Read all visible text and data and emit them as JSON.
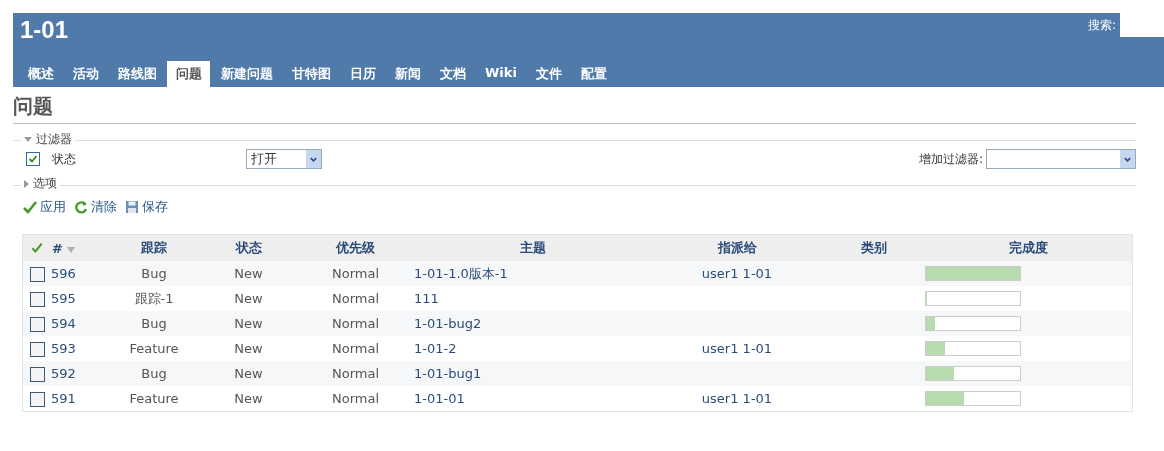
{
  "header": {
    "project_title": "1-01",
    "search_label": "搜索:"
  },
  "tabs": [
    {
      "label": "概述",
      "selected": false
    },
    {
      "label": "活动",
      "selected": false
    },
    {
      "label": "路线图",
      "selected": false
    },
    {
      "label": "问题",
      "selected": true
    },
    {
      "label": "新建问题",
      "selected": false
    },
    {
      "label": "甘特图",
      "selected": false
    },
    {
      "label": "日历",
      "selected": false
    },
    {
      "label": "新闻",
      "selected": false
    },
    {
      "label": "文档",
      "selected": false
    },
    {
      "label": "Wiki",
      "selected": false
    },
    {
      "label": "文件",
      "selected": false
    },
    {
      "label": "配置",
      "selected": false
    }
  ],
  "page_title": "问题",
  "filters": {
    "legend": "过滤器",
    "expanded": true,
    "status_label": "状态",
    "status_checked": true,
    "status_value": "打开",
    "add_filter_label": "增加过滤器:"
  },
  "options": {
    "legend": "选项",
    "expanded": false
  },
  "actions": [
    "应用",
    "清除",
    "保存"
  ],
  "table": {
    "columns": [
      "#",
      "跟踪",
      "状态",
      "优先级",
      "主题",
      "指派给",
      "类别",
      "完成度"
    ],
    "rows": [
      {
        "checked": false,
        "id": "596",
        "tracker": "Bug",
        "status": "New",
        "priority": "Normal",
        "subject": "1-01-1.0版本-1",
        "assignee": "user1 1-01",
        "level": 1.0
      },
      {
        "checked": false,
        "id": "595",
        "tracker": "跟踪-1",
        "status": "New",
        "priority": "Normal",
        "subject": "111",
        "assignee": "",
        "level": 0
      },
      {
        "checked": false,
        "id": "594",
        "tracker": "Bug",
        "status": "New",
        "priority": "Normal",
        "subject": "1-01-bug2",
        "assignee": "",
        "level": 0.1
      },
      {
        "checked": false,
        "id": "593",
        "tracker": "Feature",
        "status": "New",
        "priority": "Normal",
        "subject": "1-01-2",
        "assignee": "user1 1-01",
        "level": 0.2
      },
      {
        "checked": false,
        "id": "592",
        "tracker": "Bug",
        "status": "New",
        "priority": "Normal",
        "subject": "1-01-bug1",
        "assignee": "",
        "level": 0.3
      },
      {
        "checked": false,
        "id": "591",
        "tracker": "Feature",
        "status": "New",
        "priority": "Normal",
        "subject": "1-01-01",
        "assignee": "user1 1-01",
        "level": 0.4
      }
    ]
  }
}
